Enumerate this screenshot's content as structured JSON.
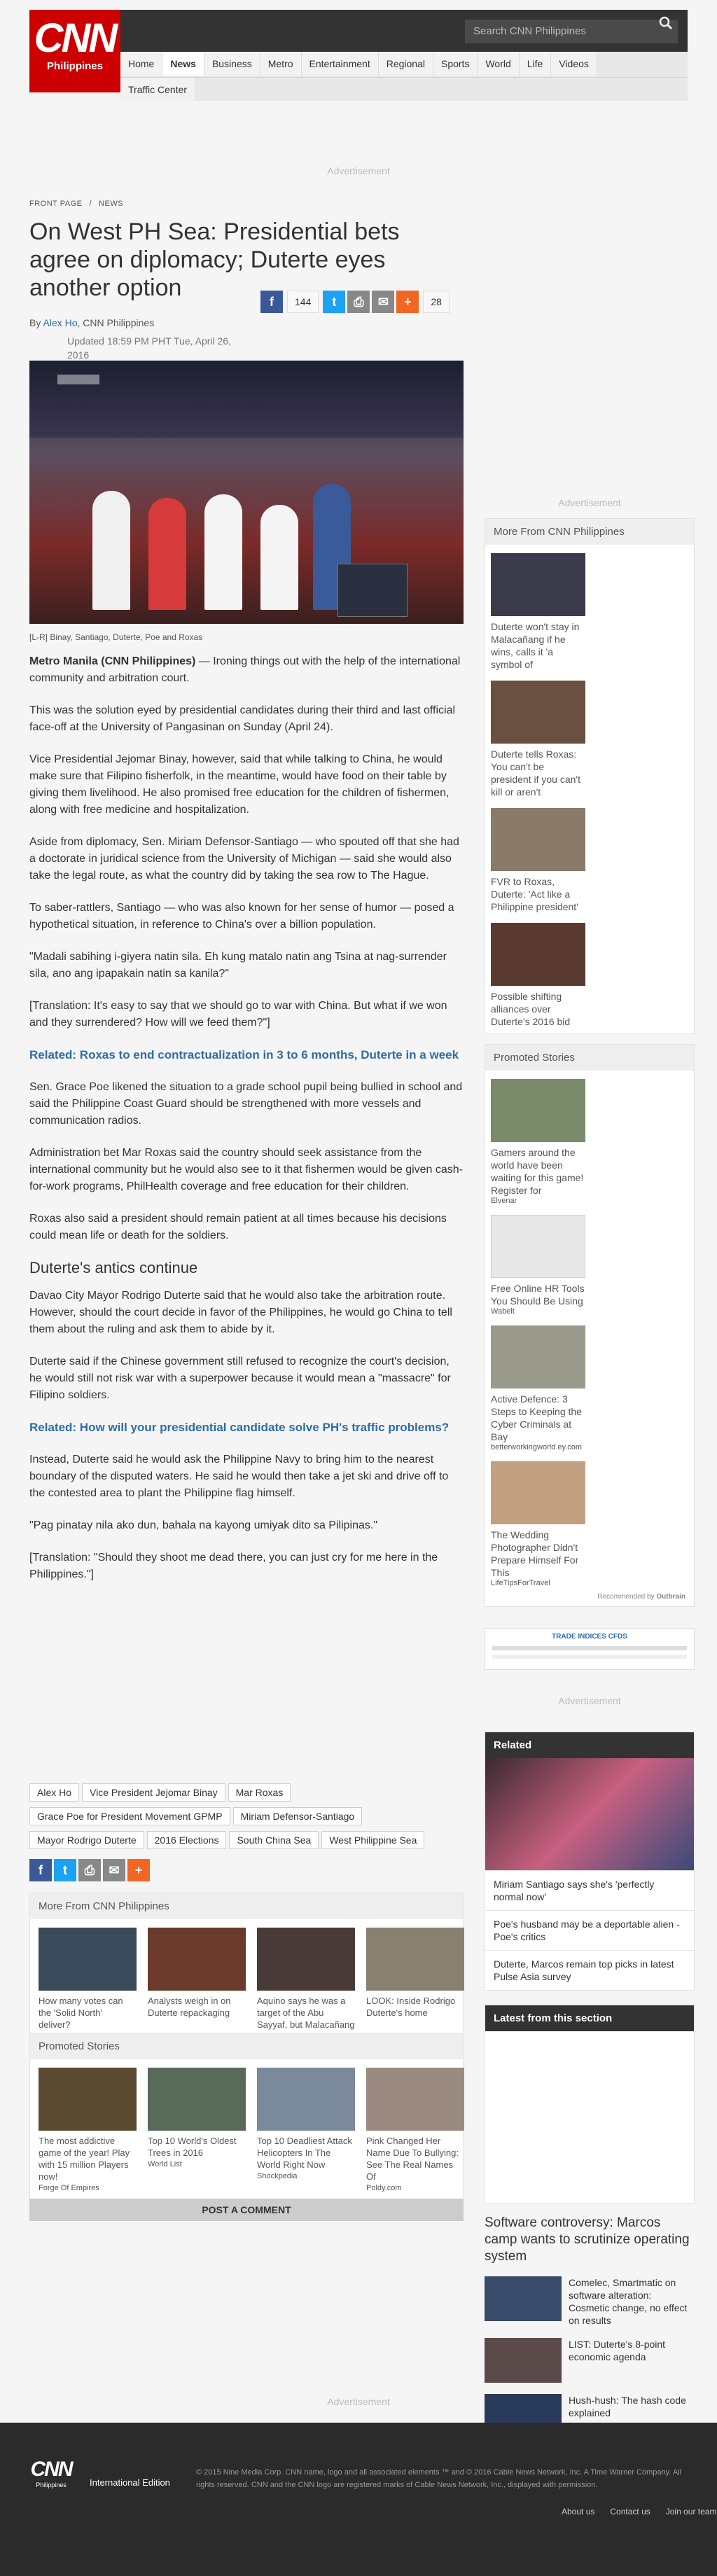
{
  "header": {
    "logo_main": "CNN",
    "logo_sub": "Philippines",
    "search_placeholder": "Search CNN Philippines",
    "nav": [
      "Home",
      "News",
      "Business",
      "Metro",
      "Entertainment",
      "Regional",
      "Sports",
      "World",
      "Life",
      "Videos",
      "Traffic Center"
    ],
    "nav_active": "News"
  },
  "ad_label": "Advertisement",
  "article": {
    "breadcrumb": [
      "FRONT PAGE",
      "/",
      "NEWS"
    ],
    "headline": "On West PH Sea: Presidential bets agree on diplomacy; Duterte eyes another option",
    "by": "By",
    "author": "Alex Ho",
    "outlet": ", CNN Philippines",
    "updated": "Updated 18:59 PM PHT Tue, April 26, 2016",
    "share": {
      "fb_count": "144",
      "comment_count": "28"
    },
    "caption": "[L-R] Binay, Santiago, Duterte, Poe and Roxas",
    "p1_bold": "Metro Manila (CNN Philippines)",
    "p1": " — Ironing things out with the help of the international community and arbitration court.",
    "p2": "This was the solution eyed by presidential candidates during their third and last official face-off at the University of Pangasinan on Sunday (April 24).",
    "p3": "Vice Presidential Jejomar Binay, however, said that while talking to China, he would make sure that Filipino fisherfolk, in the meantime, would have food on their table by giving them livelihood. He also promised free education for the children of fishermen, along with free medicine and hospitalization.",
    "p4": "Aside from diplomacy, Sen. Miriam Defensor-Santiago — who spouted off that she had a doctorate in juridical science from the University of Michigan — said she would also take the legal route, as what the country did by taking the sea row to The Hague.",
    "p5": "To saber-rattlers, Santiago — who was also known for her sense of humor — posed a hypothetical situation, in reference to China's over a billion population.",
    "p6": "\"Madali sabihing i-giyera natin sila. Eh kung matalo natin ang Tsina at nag-surrender sila, ano ang ipapakain natin sa kanila?\"",
    "p7": "[Translation: It's easy to say that we should go to war with China. But what if we won and they surrendered? How will we feed them?\"]",
    "related1": "Related: Roxas to end contractualization in 3 to 6 months, Duterte in a week",
    "p8": "Sen. Grace Poe likened the situation to a grade school pupil being bullied in school and said the Philippine Coast Guard should be strengthened with more vessels and communication radios.",
    "p9": "Administration bet Mar Roxas said the country should seek assistance from the international community but he would also see to it that fishermen would be given cash-for-work programs, PhilHealth coverage and free education for their children.",
    "p10": "Roxas also said a president should remain patient at all times because his decisions could mean life or death for the soldiers.",
    "h2": "Duterte's antics continue",
    "p11": "Davao City Mayor Rodrigo Duterte said that he would also take the arbitration route. However, should the court decide in favor of the Philippines, he would go China to tell them about the ruling and ask them to abide by it.",
    "p12": "Duterte said if the Chinese government still refused to recognize the court's decision, he would still not risk war with a superpower because it would mean a \"massacre\" for Filipino soldiers.",
    "related2": "Related: How will your presidential candidate solve PH's traffic problems?",
    "p13": "Instead, Duterte said he would ask the Philippine Navy to bring him to the nearest boundary of the disputed waters. He said he would then take a jet ski and drive off to the contested area to plant the Philippine flag himself.",
    "p14": "\"Pag pinatay nila ako dun, bahala na kayong umiyak dito sa Pilipinas.\"",
    "p15": "[Translation: \"Should they shoot me dead there, you can just cry for me here in the Philippines.\"]",
    "tags": [
      "Alex Ho",
      "Vice President Jejomar Binay",
      "Mar Roxas",
      "Grace Poe for President Movement GPMP",
      "Miriam Defensor-Santiago",
      "Mayor Rodrigo Duterte",
      "2016 Elections",
      "South China Sea",
      "West Philippine Sea"
    ]
  },
  "more_cnn": {
    "title": "More From CNN Philippines",
    "items": [
      {
        "t": "How many votes can the 'Solid North' deliver?",
        "c": "#3a4a5a"
      },
      {
        "t": "Analysts weigh in on Duterte repackaging",
        "c": "#6a3a2a"
      },
      {
        "t": "Aquino says he was a target of the Abu Sayyaf, but Malacañang refuses",
        "c": "#4a3a3a"
      },
      {
        "t": "LOOK: Inside Rodrigo Duterte's home",
        "c": "#8a8070"
      }
    ]
  },
  "promoted": {
    "title": "Promoted Stories",
    "items": [
      {
        "t": "The most addictive game of the year! Play with 15 million Players now!",
        "s": "Forge Of Empires",
        "c": "#5a4a30"
      },
      {
        "t": "Top 10 World's Oldest Trees in 2016",
        "s": "World List",
        "c": "#5a6a5a"
      },
      {
        "t": "Top 10 Deadliest Attack Helicopters In The World Right Now",
        "s": "Shockpedia",
        "c": "#7a8a9a"
      },
      {
        "t": "Pink Changed Her Name Due To Bullying: See The Real Names Of",
        "s": "Poldy.com",
        "c": "#9a8a80"
      }
    ],
    "recommended": "Recommended by",
    "brand": "Outbrain"
  },
  "post_comment": "POST A COMMENT",
  "side": {
    "more_title": "More From CNN Philippines",
    "more_items": [
      {
        "t": "Duterte won't stay in Malacañang if he wins, calls it 'a symbol of",
        "c": "#3a3a4a"
      },
      {
        "t": "Duterte tells Roxas: You can't be president if you can't kill or aren't",
        "c": "#6a5040"
      },
      {
        "t": "FVR to Roxas, Duterte: 'Act like a Philippine president'",
        "c": "#8a7a6a"
      },
      {
        "t": "Possible shifting alliances over Duterte's 2016 bid",
        "c": "#5a3a30"
      }
    ],
    "promo_title": "Promoted Stories",
    "promo_items": [
      {
        "t": "Gamers around the world have been waiting for this game! Register for",
        "s": "Elvenar",
        "c": "#7a8a6a"
      },
      {
        "t": "Free Online HR Tools You Should Be Using",
        "s": "Wabelt",
        "c": "#e8e8e8"
      },
      {
        "t": "Active Defence: 3 Steps to Keeping the Cyber Criminals at Bay",
        "s": "betterworkingworld.ey.com",
        "c": "#9a9a8a"
      },
      {
        "t": "The Wedding Photographer Didn't Prepare Himself For This",
        "s": "LifeTipsForTravel",
        "c": "#c0a080"
      }
    ],
    "trade_ad": "TRADE INDICES CFDS",
    "related_title": "Related",
    "related_items": [
      "Miriam Santiago says she's 'perfectly normal now'",
      "Poe's husband may be a deportable alien -Poe's critics",
      "Duterte, Marcos remain top picks in latest Pulse Asia survey"
    ],
    "latest_title": "Latest from this section",
    "latest_lead": "Software controversy: Marcos camp wants to scrutinize operating system",
    "latest_items": [
      {
        "t": "Comelec, Smartmatic on software alteration: Cosmetic change, no effect on results",
        "c": "#3a4a6a"
      },
      {
        "t": "LIST: Duterte's 8-point economic agenda",
        "c": "#5a4a4a"
      },
      {
        "t": "Hush-hush: The hash code explained",
        "c": "#2a3a5a"
      }
    ]
  },
  "footer": {
    "logo_main": "CNN",
    "logo_sub": "Philippines",
    "intl": "International Edition",
    "legal": "© 2015 Nine Media Corp. CNN name, logo and all associated elements ™ and © 2016 Cable News Network, Inc. A Time Warner Company. All rights reserved. CNN and the CNN logo are registered marks of Cable News Network, Inc., displayed with permission.",
    "links": [
      "About us",
      "Contact us",
      "Join our team"
    ]
  }
}
